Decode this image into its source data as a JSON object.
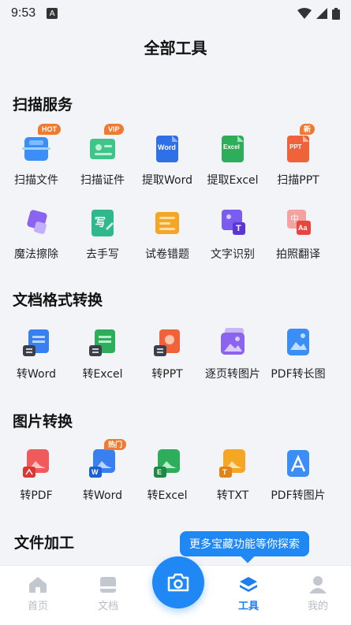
{
  "status": {
    "time": "9:53",
    "app_indicator": "A"
  },
  "header": {
    "title": "全部工具"
  },
  "sections": [
    {
      "title": "扫描服务",
      "tools": [
        {
          "label": "扫描文件",
          "badge": "HOT"
        },
        {
          "label": "扫描证件",
          "badge": "VIP"
        },
        {
          "label": "提取Word",
          "icon_text": "Word"
        },
        {
          "label": "提取Excel",
          "icon_text": "Excel"
        },
        {
          "label": "扫描PPT",
          "badge": "新",
          "icon_text": "PPT"
        },
        {
          "label": "魔法擦除"
        },
        {
          "label": "去手写",
          "icon_text": "写"
        },
        {
          "label": "试卷错题"
        },
        {
          "label": "文字识别",
          "icon_text": "T"
        },
        {
          "label": "拍照翻译",
          "icon_text": "中",
          "icon_text_2": "Aa"
        }
      ]
    },
    {
      "title": "文档格式转换",
      "tools": [
        {
          "label": "转Word"
        },
        {
          "label": "转Excel"
        },
        {
          "label": "转PPT"
        },
        {
          "label": "逐页转图片"
        },
        {
          "label": "PDF转长图"
        }
      ]
    },
    {
      "title": "图片转换",
      "tools": [
        {
          "label": "转PDF"
        },
        {
          "label": "转Word",
          "badge": "热门",
          "icon_text": "W"
        },
        {
          "label": "转Excel",
          "icon_text": "E"
        },
        {
          "label": "转TXT",
          "icon_text": "T"
        },
        {
          "label": "PDF转图片"
        }
      ]
    },
    {
      "title": "文件加工"
    }
  ],
  "tooltip": "更多宝藏功能等你探索",
  "tabbar": [
    {
      "label": "首页"
    },
    {
      "label": "文档"
    },
    {
      "label": "工具"
    },
    {
      "label": "我的"
    }
  ],
  "colors": {
    "accent": "#1f88f5",
    "badge": "#f07a2f",
    "tab_inactive": "#b7bcc6"
  }
}
